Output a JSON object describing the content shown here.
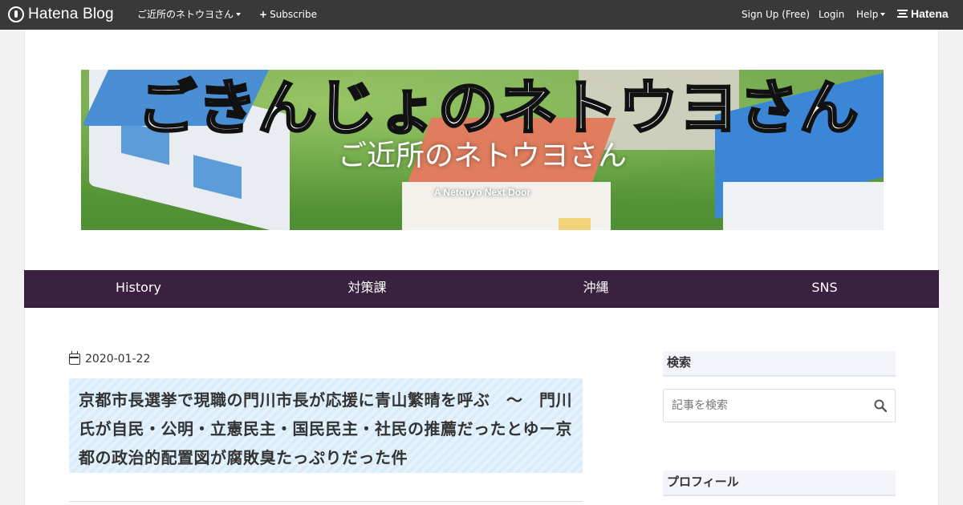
{
  "topbar": {
    "brand": "Hatena Blog",
    "blog_menu": "ご近所のネトウヨさん",
    "subscribe": "Subscribe",
    "signup": "Sign Up (Free)",
    "login": "Login",
    "help": "Help",
    "hatena": "Hatena"
  },
  "header": {
    "logo_text": "ごきんじょのネトウヨさん",
    "title": "ご近所のネトウヨさん",
    "subtitle": "A Netouyo Next Door"
  },
  "nav": {
    "items": [
      {
        "label": "History"
      },
      {
        "label": "対策課"
      },
      {
        "label": "沖縄"
      },
      {
        "label": "SNS"
      }
    ]
  },
  "article": {
    "date": "2020-01-22",
    "title": "京都市長選挙で現職の門川市長が応援に青山繁晴を呼ぶ　～　門川氏が自民・公明・立憲民主・国民民主・社民の推薦だったとゆー京都の政治的配置図が腐敗臭たっぷりだった件"
  },
  "sidebar": {
    "search_heading": "検索",
    "search_placeholder": "記事を検索",
    "profile_heading": "プロフィール"
  },
  "colors": {
    "topbar": "#393939",
    "nav": "#3b2140",
    "title_stripe": "#d8ecfa"
  }
}
